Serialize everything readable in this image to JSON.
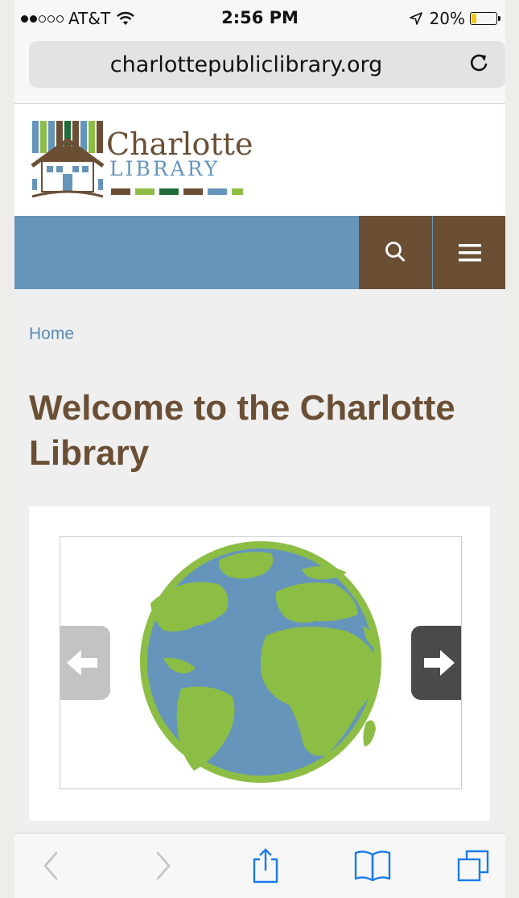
{
  "status": {
    "carrier": "AT&T",
    "time": "2:56 PM",
    "battery": "20%",
    "battery_level": 0.2
  },
  "browser": {
    "url": "charlottepubliclibrary.org"
  },
  "logo": {
    "name": "Charlotte",
    "sub": "LIBRARY"
  },
  "breadcrumb": {
    "home": "Home"
  },
  "page": {
    "title": "Welcome to the Charlotte Library"
  },
  "colors": {
    "nav_bar": "#6595bb",
    "nav_button": "#6b4f35",
    "title": "#6b4f35",
    "link": "#5b8db7",
    "globe_ocean": "#6595bb",
    "globe_land": "#8cbd45"
  },
  "icons": {
    "search": "search-icon",
    "menu": "hamburger-menu-icon",
    "reload": "reload-icon",
    "prev": "arrow-left-icon",
    "next": "arrow-right-icon",
    "back": "chevron-left-icon",
    "forward": "chevron-right-icon",
    "share": "share-icon",
    "bookmarks": "book-icon",
    "tabs": "tabs-icon"
  }
}
